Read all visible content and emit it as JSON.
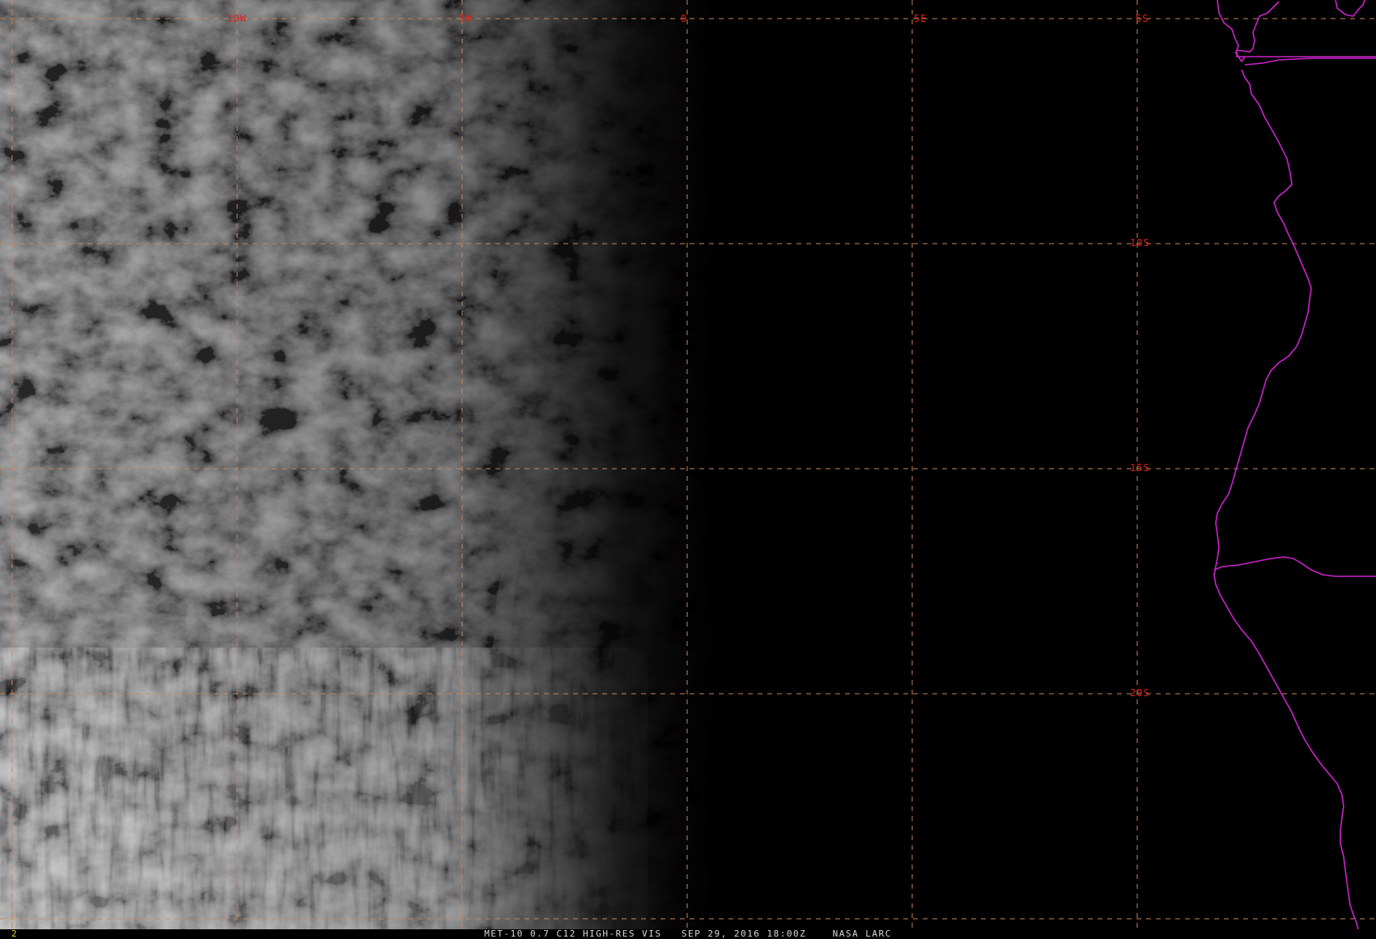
{
  "map": {
    "longitude_labels": [
      "10W",
      "5W",
      "0",
      "5E"
    ],
    "latitude_labels": [
      "5S",
      "10S",
      "15S",
      "20S"
    ],
    "grid_color": "#c8885a",
    "label_color": "#e0201c",
    "boundary_color": "#cc22cc",
    "coast_color": "#cc22cc"
  },
  "status": {
    "frame_number": "2",
    "caption": "MET-10 0.7 C12 HIGH-RES VIS   SEP 29, 2016 18:00Z    NASA LARC"
  }
}
